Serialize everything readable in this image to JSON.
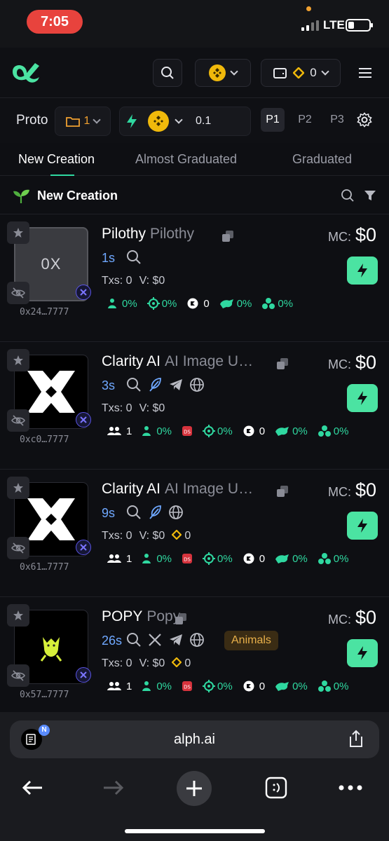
{
  "status_bar": {
    "time": "7:05",
    "network": "LTE"
  },
  "header": {
    "chain_selector": "bnb-icon",
    "wallet_balance": "0"
  },
  "protocol_bar": {
    "label": "Proto",
    "filter_count": "1",
    "quick_buy_amount": "0.1",
    "presets": [
      "P1",
      "P2",
      "P3"
    ],
    "active_preset": "P1"
  },
  "tabs": [
    {
      "label": "New Creation",
      "active": true
    },
    {
      "label": "Almost Graduated",
      "active": false
    },
    {
      "label": "Graduated",
      "active": false
    }
  ],
  "section": {
    "title": "New Creation"
  },
  "tokens": [
    {
      "name": "Pilothy",
      "ticker": "Pilothy",
      "thumb_text": "0X",
      "address": "0x24…7777",
      "age": "1s",
      "mc_label": "MC:",
      "mc": "$0",
      "txs": "Txs: 0",
      "volume": "V: $0",
      "extra": "",
      "holders": "",
      "top10": "0%",
      "ds": false,
      "snipers": "0%",
      "bundles": "0",
      "dev": "0%",
      "insiders": "0%",
      "socials": [
        "search"
      ],
      "tag": ""
    },
    {
      "name": "Clarity AI",
      "ticker": "AI Image U…",
      "thumb_text": "",
      "address": "0xc0…7777",
      "age": "3s",
      "mc_label": "MC:",
      "mc": "$0",
      "txs": "Txs: 0",
      "volume": "V: $0",
      "extra": "",
      "holders": "1",
      "top10": "0%",
      "ds": true,
      "snipers": "0%",
      "bundles": "0",
      "dev": "0%",
      "insiders": "0%",
      "socials": [
        "search",
        "feather",
        "telegram",
        "globe"
      ],
      "tag": ""
    },
    {
      "name": "Clarity AI",
      "ticker": "AI Image U…",
      "thumb_text": "",
      "address": "0x61…7777",
      "age": "9s",
      "mc_label": "MC:",
      "mc": "$0",
      "txs": "Txs: 0",
      "volume": "V: $0",
      "extra": "0",
      "holders": "1",
      "top10": "0%",
      "ds": true,
      "snipers": "0%",
      "bundles": "0",
      "dev": "0%",
      "insiders": "0%",
      "socials": [
        "search",
        "feather",
        "globe"
      ],
      "tag": ""
    },
    {
      "name": "POPY",
      "ticker": "Popy",
      "thumb_text": "",
      "address": "0x57…7777",
      "age": "26s",
      "mc_label": "MC:",
      "mc": "$0",
      "txs": "Txs: 0",
      "volume": "V: $0",
      "extra": "0",
      "holders": "1",
      "top10": "0%",
      "ds": true,
      "snipers": "0%",
      "bundles": "0",
      "dev": "0%",
      "insiders": "0%",
      "socials": [
        "search",
        "x",
        "telegram",
        "globe"
      ],
      "tag": "Animals"
    }
  ],
  "browser": {
    "url": "alph.ai"
  },
  "colors": {
    "accent": "#2fd8a0",
    "buy": "#4be3a2",
    "age": "#6fa8ff",
    "bnb": "#f0b90b",
    "time_pill": "#e8433d"
  }
}
